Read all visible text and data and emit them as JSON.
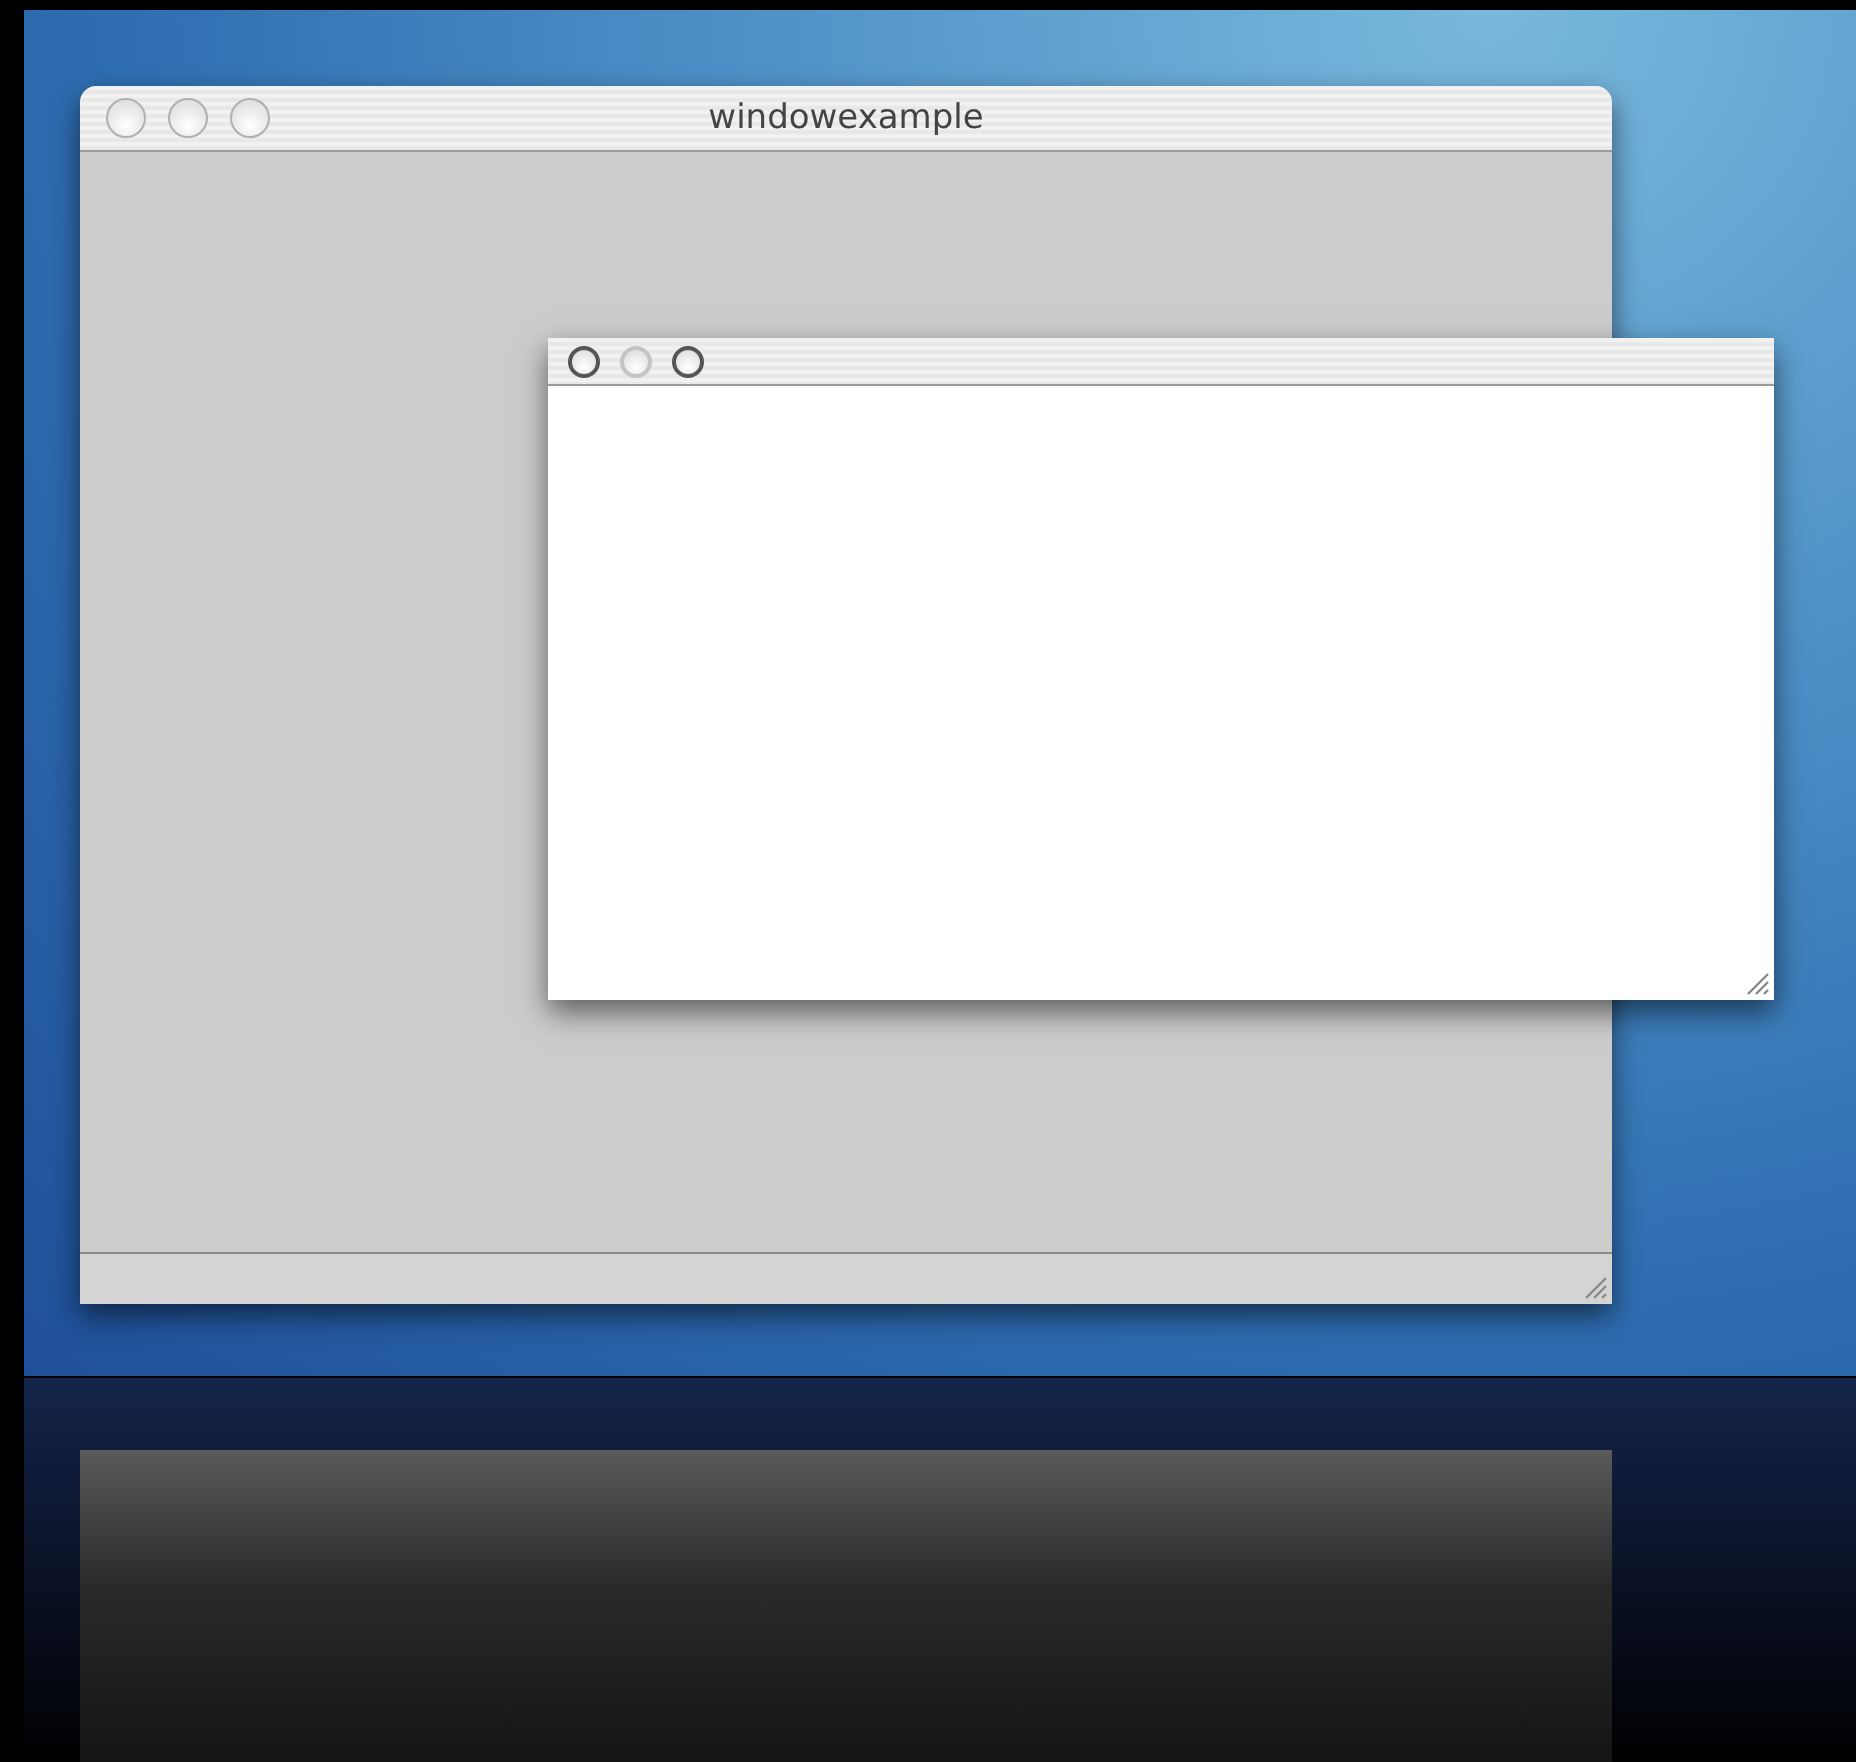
{
  "windows": [
    {
      "title": "windowexample",
      "active": false,
      "status_bar": true,
      "kind": "panel",
      "buttons": [
        {
          "disabled": false
        },
        {
          "disabled": false
        },
        {
          "disabled": false
        }
      ]
    },
    {
      "active": true,
      "status_bar": false,
      "kind": "document",
      "buttons": [
        {
          "disabled": false
        },
        {
          "disabled": true
        },
        {
          "disabled": false
        }
      ]
    }
  ]
}
